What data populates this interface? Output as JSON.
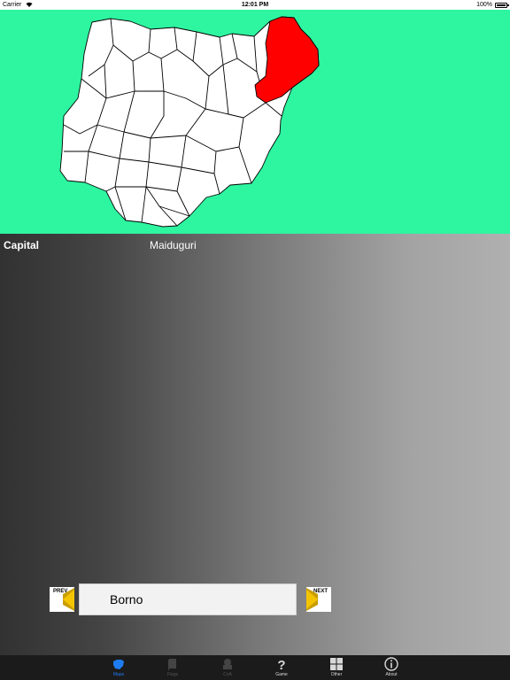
{
  "status_bar": {
    "carrier": "Carrier",
    "time": "12:01 PM",
    "battery": "100%"
  },
  "map": {
    "highlight_color": "#ff0000",
    "background_color": "#2ef5a0",
    "state_fill": "#ffffff"
  },
  "detail": {
    "capital_label": "Capital",
    "capital_value": "Maiduguri"
  },
  "navigator": {
    "prev_label": "PREV",
    "next_label": "NEXT",
    "state_name": "Borno",
    "arrow_color": "#f5c400"
  },
  "tabs": [
    {
      "label": "Maps",
      "icon": "map-icon",
      "state": "active"
    },
    {
      "label": "Flags",
      "icon": "flag-icon",
      "state": "disabled"
    },
    {
      "label": "CoA",
      "icon": "coat-of-arms-icon",
      "state": "disabled"
    },
    {
      "label": "Game",
      "icon": "question-icon",
      "state": "normal"
    },
    {
      "label": "Other",
      "icon": "grid-icon",
      "state": "normal"
    },
    {
      "label": "About",
      "icon": "info-icon",
      "state": "normal"
    }
  ],
  "colors": {
    "active_tab": "#1e7cf2",
    "tab_bar": "#1b1b1b"
  }
}
